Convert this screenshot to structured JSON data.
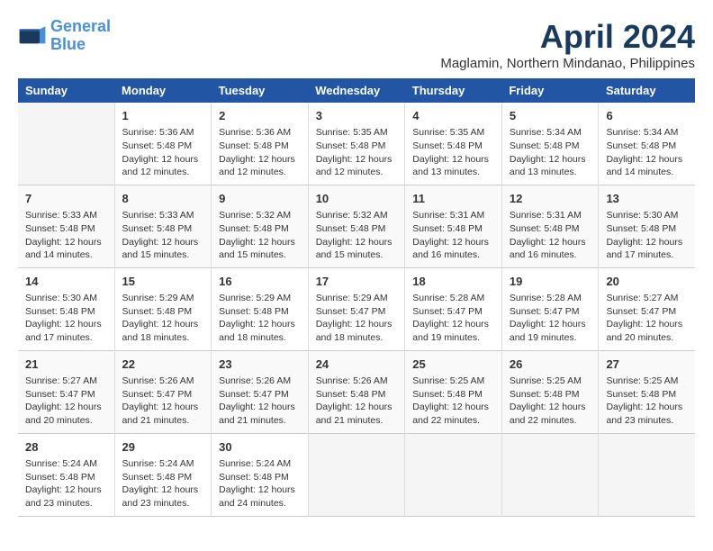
{
  "header": {
    "logo_line1": "General",
    "logo_line2": "Blue",
    "month": "April 2024",
    "location": "Maglamin, Northern Mindanao, Philippines"
  },
  "weekdays": [
    "Sunday",
    "Monday",
    "Tuesday",
    "Wednesday",
    "Thursday",
    "Friday",
    "Saturday"
  ],
  "weeks": [
    [
      {
        "day": "",
        "info": ""
      },
      {
        "day": "1",
        "info": "Sunrise: 5:36 AM\nSunset: 5:48 PM\nDaylight: 12 hours\nand 12 minutes."
      },
      {
        "day": "2",
        "info": "Sunrise: 5:36 AM\nSunset: 5:48 PM\nDaylight: 12 hours\nand 12 minutes."
      },
      {
        "day": "3",
        "info": "Sunrise: 5:35 AM\nSunset: 5:48 PM\nDaylight: 12 hours\nand 12 minutes."
      },
      {
        "day": "4",
        "info": "Sunrise: 5:35 AM\nSunset: 5:48 PM\nDaylight: 12 hours\nand 13 minutes."
      },
      {
        "day": "5",
        "info": "Sunrise: 5:34 AM\nSunset: 5:48 PM\nDaylight: 12 hours\nand 13 minutes."
      },
      {
        "day": "6",
        "info": "Sunrise: 5:34 AM\nSunset: 5:48 PM\nDaylight: 12 hours\nand 14 minutes."
      }
    ],
    [
      {
        "day": "7",
        "info": "Sunrise: 5:33 AM\nSunset: 5:48 PM\nDaylight: 12 hours\nand 14 minutes."
      },
      {
        "day": "8",
        "info": "Sunrise: 5:33 AM\nSunset: 5:48 PM\nDaylight: 12 hours\nand 15 minutes."
      },
      {
        "day": "9",
        "info": "Sunrise: 5:32 AM\nSunset: 5:48 PM\nDaylight: 12 hours\nand 15 minutes."
      },
      {
        "day": "10",
        "info": "Sunrise: 5:32 AM\nSunset: 5:48 PM\nDaylight: 12 hours\nand 15 minutes."
      },
      {
        "day": "11",
        "info": "Sunrise: 5:31 AM\nSunset: 5:48 PM\nDaylight: 12 hours\nand 16 minutes."
      },
      {
        "day": "12",
        "info": "Sunrise: 5:31 AM\nSunset: 5:48 PM\nDaylight: 12 hours\nand 16 minutes."
      },
      {
        "day": "13",
        "info": "Sunrise: 5:30 AM\nSunset: 5:48 PM\nDaylight: 12 hours\nand 17 minutes."
      }
    ],
    [
      {
        "day": "14",
        "info": "Sunrise: 5:30 AM\nSunset: 5:48 PM\nDaylight: 12 hours\nand 17 minutes."
      },
      {
        "day": "15",
        "info": "Sunrise: 5:29 AM\nSunset: 5:48 PM\nDaylight: 12 hours\nand 18 minutes."
      },
      {
        "day": "16",
        "info": "Sunrise: 5:29 AM\nSunset: 5:48 PM\nDaylight: 12 hours\nand 18 minutes."
      },
      {
        "day": "17",
        "info": "Sunrise: 5:29 AM\nSunset: 5:47 PM\nDaylight: 12 hours\nand 18 minutes."
      },
      {
        "day": "18",
        "info": "Sunrise: 5:28 AM\nSunset: 5:47 PM\nDaylight: 12 hours\nand 19 minutes."
      },
      {
        "day": "19",
        "info": "Sunrise: 5:28 AM\nSunset: 5:47 PM\nDaylight: 12 hours\nand 19 minutes."
      },
      {
        "day": "20",
        "info": "Sunrise: 5:27 AM\nSunset: 5:47 PM\nDaylight: 12 hours\nand 20 minutes."
      }
    ],
    [
      {
        "day": "21",
        "info": "Sunrise: 5:27 AM\nSunset: 5:47 PM\nDaylight: 12 hours\nand 20 minutes."
      },
      {
        "day": "22",
        "info": "Sunrise: 5:26 AM\nSunset: 5:47 PM\nDaylight: 12 hours\nand 21 minutes."
      },
      {
        "day": "23",
        "info": "Sunrise: 5:26 AM\nSunset: 5:47 PM\nDaylight: 12 hours\nand 21 minutes."
      },
      {
        "day": "24",
        "info": "Sunrise: 5:26 AM\nSunset: 5:48 PM\nDaylight: 12 hours\nand 21 minutes."
      },
      {
        "day": "25",
        "info": "Sunrise: 5:25 AM\nSunset: 5:48 PM\nDaylight: 12 hours\nand 22 minutes."
      },
      {
        "day": "26",
        "info": "Sunrise: 5:25 AM\nSunset: 5:48 PM\nDaylight: 12 hours\nand 22 minutes."
      },
      {
        "day": "27",
        "info": "Sunrise: 5:25 AM\nSunset: 5:48 PM\nDaylight: 12 hours\nand 23 minutes."
      }
    ],
    [
      {
        "day": "28",
        "info": "Sunrise: 5:24 AM\nSunset: 5:48 PM\nDaylight: 12 hours\nand 23 minutes."
      },
      {
        "day": "29",
        "info": "Sunrise: 5:24 AM\nSunset: 5:48 PM\nDaylight: 12 hours\nand 23 minutes."
      },
      {
        "day": "30",
        "info": "Sunrise: 5:24 AM\nSunset: 5:48 PM\nDaylight: 12 hours\nand 24 minutes."
      },
      {
        "day": "",
        "info": ""
      },
      {
        "day": "",
        "info": ""
      },
      {
        "day": "",
        "info": ""
      },
      {
        "day": "",
        "info": ""
      }
    ]
  ]
}
